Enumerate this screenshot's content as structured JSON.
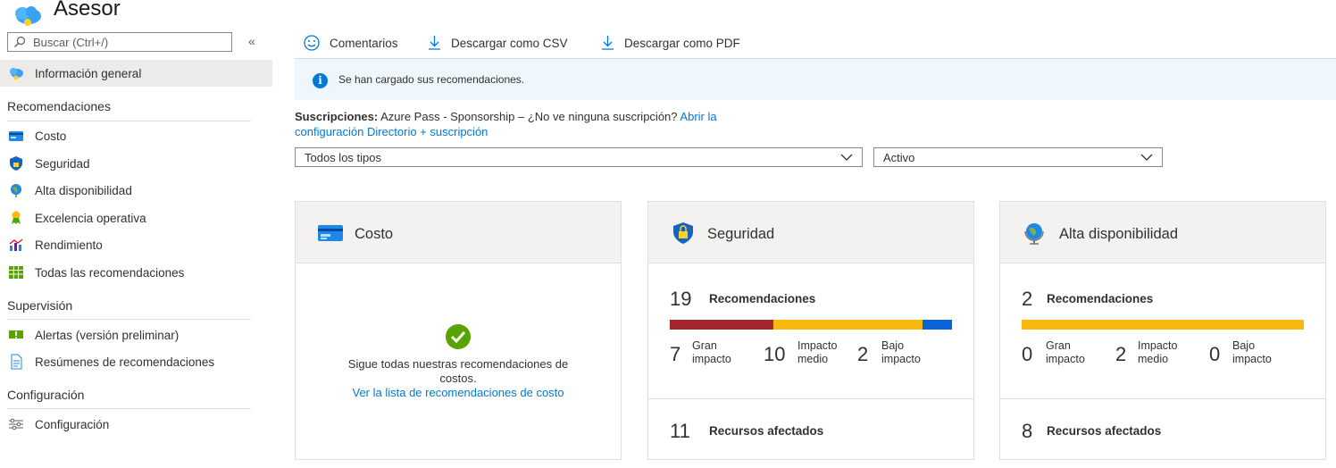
{
  "app": {
    "title": "Asesor"
  },
  "search": {
    "placeholder": "Buscar (Ctrl+/)"
  },
  "sidebar": {
    "collapse_glyph": "«",
    "overview": "Información general",
    "sections": {
      "recommendations": "Recomendaciones",
      "monitoring": "Supervisión",
      "settings": "Configuración"
    },
    "items": {
      "cost": "Costo",
      "security": "Seguridad",
      "ha": "Alta disponibilidad",
      "opex": "Excelencia operativa",
      "perf": "Rendimiento",
      "all": "Todas las recomendaciones",
      "alerts": "Alertas (versión preliminar)",
      "digests": "Resúmenes de recomendaciones",
      "config": "Configuración"
    }
  },
  "toolbar": {
    "feedback": "Comentarios",
    "csv": "Descargar como CSV",
    "pdf": "Descargar como PDF"
  },
  "info_bar": {
    "text": "Se han cargado sus recomendaciones."
  },
  "subscriptions": {
    "label": "Suscripciones:",
    "text": "Azure Pass - Sponsorship – ¿No ve ninguna suscripción?",
    "link_1": "Abrir la",
    "link_2": "configuración Directorio + suscripción"
  },
  "filters": {
    "type": "Todos los tipos",
    "status": "Activo"
  },
  "cards": {
    "cost": {
      "title": "Costo",
      "message_1": "Sigue todas nuestras recomendaciones de",
      "message_2": "costos.",
      "link": "Ver la lista de recomendaciones de costo"
    },
    "security": {
      "title": "Seguridad",
      "count": "19",
      "count_label": "Recomendaciones",
      "high": "7",
      "medium": "10",
      "low": "2",
      "high_l1": "Gran",
      "high_l2": "impacto",
      "medium_l1": "Impacto",
      "medium_l2": "medio",
      "low_l1": "Bajo",
      "low_l2": "impacto",
      "affected": "11",
      "affected_label": "Recursos afectados"
    },
    "ha": {
      "title": "Alta disponibilidad",
      "count": "2",
      "count_label": "Recomendaciones",
      "high": "0",
      "medium": "2",
      "low": "0",
      "high_l1": "Gran",
      "high_l2": "impacto",
      "medium_l1": "Impacto",
      "medium_l2": "medio",
      "low_l1": "Bajo",
      "low_l2": "impacto",
      "affected": "8",
      "affected_label": "Recursos afectados"
    }
  },
  "colors": {
    "high": "#a4262c",
    "medium": "#f8b80e",
    "low": "#0b64d8",
    "accent": "#0078d4",
    "success": "#57a300"
  }
}
